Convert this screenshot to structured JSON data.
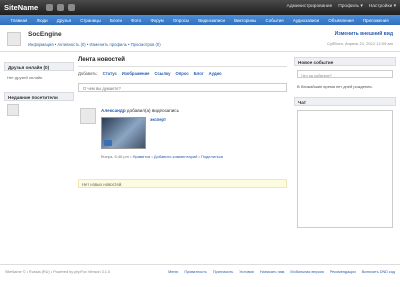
{
  "app": {
    "site_name": "SiteName"
  },
  "topbar": {
    "links": [
      "Администрирование",
      "Профиль ▾",
      "Настройки ▾"
    ]
  },
  "nav": {
    "items": [
      "Главная",
      "Люди",
      "Друзья",
      "Страницы",
      "Блоги",
      "Фото",
      "Форум",
      "Опросы",
      "Видеозаписи",
      "Викторины",
      "События",
      "Аудиозаписи",
      "Объявления",
      "Приложения"
    ]
  },
  "profile": {
    "name": "SocEngine",
    "links": "Информация • Активность (0) • Изменить профиль • Просмотров (0)",
    "edit_link": "Изменить внешний вид",
    "date": "Суббота, Апрель 21, 2012 12:09 am"
  },
  "left": {
    "friends_title": "Друзья онлайн (0)",
    "friends_empty": "Нет друзей онлайн.",
    "visitors_title": "Недавние посетители"
  },
  "feed": {
    "title": "Лента новостей",
    "add_label": "Добавить:",
    "add_items": [
      "Статус",
      "Изображение",
      "Ссылку",
      "Опрос",
      "Блог",
      "Аудио"
    ],
    "status_placeholder": "О чем вы думаете?",
    "post": {
      "author": "Александр",
      "action": "добавил(а) видеозапись",
      "video_title": "эксперт",
      "meta_time": "Вчера, 6:46 pm",
      "meta_like": "Нравится",
      "meta_comment": "Добавить комментарий",
      "meta_share": "Поделиться"
    },
    "no_more": "Нет новых новостей."
  },
  "right": {
    "event_title": "Новое событие",
    "event_placeholder": "Что за событие?",
    "birthday_note": "В ближайшие время нет дней рождения.",
    "chat_title": "Чат"
  },
  "footer": {
    "left": "SiteName © • Russia (RU) • Powered by phpFox Version 3.1.0",
    "links": [
      "Меню",
      "Приватность",
      "Пригласить",
      "Условия",
      "Написать нам",
      "Мобильная версия",
      "Рекомендации",
      "Включить DND код"
    ]
  }
}
